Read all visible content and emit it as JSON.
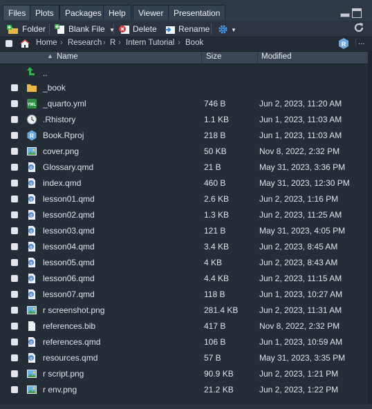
{
  "tabs": [
    {
      "label": "Files",
      "active": true
    },
    {
      "label": "Plots"
    },
    {
      "label": "Packages"
    },
    {
      "label": "Help"
    },
    {
      "label": "Viewer"
    },
    {
      "label": "Presentation"
    }
  ],
  "toolbar": {
    "folder_label": "Folder",
    "blank_file_label": "Blank File",
    "delete_label": "Delete",
    "rename_label": "Rename"
  },
  "breadcrumb": [
    "Home",
    "Research",
    "R",
    "Intern Tutorial",
    "Book"
  ],
  "breadcrumb_more": "...",
  "columns": {
    "name": "Name",
    "size": "Size",
    "modified": "Modified"
  },
  "parent_dir": "..",
  "files": [
    {
      "name": "_book",
      "size": "",
      "modified": "",
      "type": "folder"
    },
    {
      "name": "_quarto.yml",
      "size": "746 B",
      "modified": "Jun 2, 2023, 11:20 AM",
      "type": "yml"
    },
    {
      "name": ".Rhistory",
      "size": "1.1 KB",
      "modified": "Jun 1, 2023, 11:03 AM",
      "type": "rhistory"
    },
    {
      "name": "Book.Rproj",
      "size": "218 B",
      "modified": "Jun 1, 2023, 11:03 AM",
      "type": "rproj"
    },
    {
      "name": "cover.png",
      "size": "50 KB",
      "modified": "Nov 8, 2022, 2:32 PM",
      "type": "png"
    },
    {
      "name": "Glossary.qmd",
      "size": "21 B",
      "modified": "May 31, 2023, 3:36 PM",
      "type": "qmd"
    },
    {
      "name": "index.qmd",
      "size": "460 B",
      "modified": "May 31, 2023, 12:30 PM",
      "type": "qmd"
    },
    {
      "name": "lesson01.qmd",
      "size": "2.6 KB",
      "modified": "Jun 2, 2023, 1:16 PM",
      "type": "qmd"
    },
    {
      "name": "lesson02.qmd",
      "size": "1.3 KB",
      "modified": "Jun 2, 2023, 11:25 AM",
      "type": "qmd"
    },
    {
      "name": "lesson03.qmd",
      "size": "121 B",
      "modified": "May 31, 2023, 4:05 PM",
      "type": "qmd"
    },
    {
      "name": "lesson04.qmd",
      "size": "3.4 KB",
      "modified": "Jun 2, 2023, 8:45 AM",
      "type": "qmd"
    },
    {
      "name": "lesson05.qmd",
      "size": "4 KB",
      "modified": "Jun 2, 2023, 8:43 AM",
      "type": "qmd"
    },
    {
      "name": "lesson06.qmd",
      "size": "4.4 KB",
      "modified": "Jun 2, 2023, 11:15 AM",
      "type": "qmd"
    },
    {
      "name": "lesson07.qmd",
      "size": "118 B",
      "modified": "Jun 1, 2023, 10:27 AM",
      "type": "qmd"
    },
    {
      "name": "r screenshot.png",
      "size": "281.4 KB",
      "modified": "Jun 2, 2023, 11:31 AM",
      "type": "png"
    },
    {
      "name": "references.bib",
      "size": "417 B",
      "modified": "Nov 8, 2022, 2:32 PM",
      "type": "bib"
    },
    {
      "name": "references.qmd",
      "size": "106 B",
      "modified": "Jun 1, 2023, 10:59 AM",
      "type": "qmd"
    },
    {
      "name": "resources.qmd",
      "size": "57 B",
      "modified": "May 31, 2023, 3:35 PM",
      "type": "qmd"
    },
    {
      "name": "r script.png",
      "size": "90.9 KB",
      "modified": "Jun 2, 2023, 1:21 PM",
      "type": "png"
    },
    {
      "name": "r env.png",
      "size": "21.2 KB",
      "modified": "Jun 2, 2023, 1:22 PM",
      "type": "png"
    }
  ],
  "colors": {
    "accent": "#2b84d8",
    "folder": "#e8b94a",
    "green_arrow": "#33b34a",
    "delete_red": "#d23c3c"
  }
}
